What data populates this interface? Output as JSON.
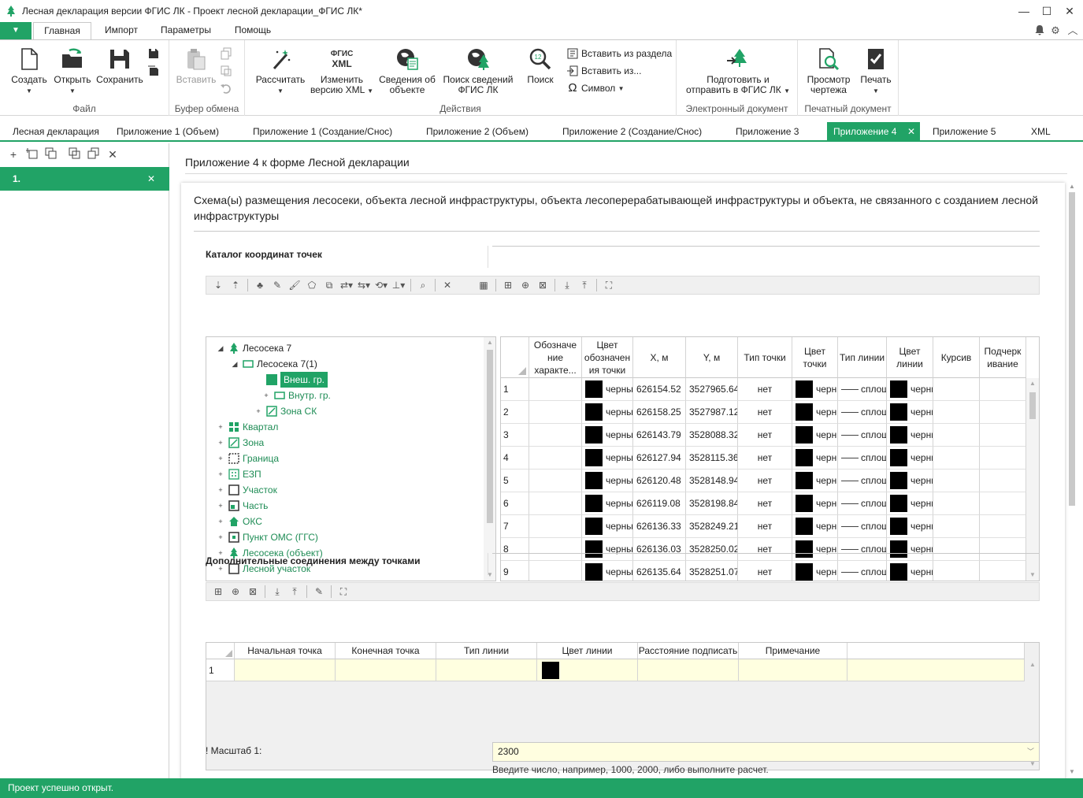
{
  "window": {
    "title": "Лесная декларация версии ФГИС ЛК - Проект лесной декларации_ФГИС ЛК*",
    "minimize": "—",
    "maximize": "☐",
    "close": "✕"
  },
  "ribbon_tabs": {
    "file_menu": "▼",
    "tabs": [
      {
        "label": "Главная",
        "active": true
      },
      {
        "label": "Импорт"
      },
      {
        "label": "Параметры"
      },
      {
        "label": "Помощь"
      }
    ]
  },
  "ribbon": {
    "groups": {
      "file": {
        "label": "Файл",
        "create": "Создать",
        "open": "Открыть",
        "save": "Сохранить"
      },
      "clipboard": {
        "label": "Буфер обмена",
        "paste": "Вставить"
      },
      "actions": {
        "label": "Действия",
        "calculate": "Рассчитать",
        "change_xml_1": "Изменить",
        "change_xml_2": "версию XML",
        "xml_badge_1": "ФГИС",
        "xml_badge_2": "XML",
        "object_info_1": "Сведения об",
        "object_info_2": "объекте",
        "search_info_1": "Поиск сведений",
        "search_info_2": "ФГИС ЛК",
        "search": "Поиск",
        "insert_from_section": "Вставить из раздела",
        "insert_from": "Вставить из...",
        "symbol": "Символ"
      },
      "edoc": {
        "label": "Электронный документ",
        "prepare_1": "Подготовить и",
        "prepare_2": "отправить в ФГИС ЛК"
      },
      "print": {
        "label": "Печатный документ",
        "preview_1": "Просмотр",
        "preview_2": "чертежа",
        "print": "Печать"
      }
    }
  },
  "doc_tabs": [
    {
      "label": "Лесная декларация"
    },
    {
      "label": "Приложение 1 (Объем)"
    },
    {
      "label": "Приложение 1 (Создание/Снос)"
    },
    {
      "label": "Приложение 2 (Объем)"
    },
    {
      "label": "Приложение 2 (Создание/Снос)"
    },
    {
      "label": "Приложение 3"
    },
    {
      "label": "Приложение 4",
      "active": true,
      "close": "✕"
    },
    {
      "label": "Приложение 5"
    },
    {
      "label": "XML"
    }
  ],
  "left_panel": {
    "item_label": "1.",
    "item_close": "✕"
  },
  "main": {
    "page_title": "Приложение 4 к форме Лесной декларации",
    "card_title": "Схема(ы) размещения лесосеки, объекта лесной инфраструктуры, объекта лесоперерабатывающей инфраструктуры и объекта, не связанного с созданием лесной инфраструктуры",
    "catalog_label": "Каталог координат точек",
    "connections_label": "Дополнительные соединения между точками",
    "scale_label": "! Масштаб 1:",
    "scale_value": "2300",
    "scale_hint": "Введите число, например, 1000, 2000, либо выполните расчет."
  },
  "tree": [
    {
      "label": "Лесосека 7",
      "exp": "◢",
      "icon": "tree-icon",
      "level": 0,
      "dark": true
    },
    {
      "label": "Лесосека 7(1)",
      "exp": "◢",
      "icon": "rect-icon",
      "level": 1,
      "dark": true
    },
    {
      "label": "Внеш. гр.",
      "exp": "",
      "icon": "rect-icon",
      "level": 2,
      "selected": true
    },
    {
      "label": "Внутр. гр.",
      "exp": "+",
      "icon": "rect-icon",
      "level": 3
    },
    {
      "label": "Зона СК",
      "exp": "+",
      "icon": "zone-icon",
      "level": 2
    },
    {
      "label": "Квартал",
      "exp": "+",
      "icon": "grid-icon",
      "level": 0
    },
    {
      "label": "Зона",
      "exp": "+",
      "icon": "zone-icon",
      "level": 0
    },
    {
      "label": "Граница",
      "exp": "+",
      "icon": "dashed-rect-icon",
      "level": 0
    },
    {
      "label": "ЕЗП",
      "exp": "+",
      "icon": "dots-icon",
      "level": 0
    },
    {
      "label": "Участок",
      "exp": "+",
      "icon": "square-icon",
      "level": 0
    },
    {
      "label": "Часть",
      "exp": "+",
      "icon": "part-icon",
      "level": 0
    },
    {
      "label": "ОКС",
      "exp": "+",
      "icon": "house-icon",
      "level": 0
    },
    {
      "label": "Пункт ОМС (ГГС)",
      "exp": "+",
      "icon": "point-icon",
      "level": 0
    },
    {
      "label": "Лесосека (объект)",
      "exp": "+",
      "icon": "tree-icon",
      "level": 0
    },
    {
      "label": "Лесной участок",
      "exp": "+",
      "icon": "square-icon",
      "level": 0
    }
  ],
  "coord_grid": {
    "headers": [
      "",
      "Обозначе ние характе...",
      "Цвет обозначен ия точки",
      "X, м",
      "Y, м",
      "Тип точки",
      "Цвет точки",
      "Тип линии",
      "Цвет линии",
      "Курсив",
      "Подчерк ивание"
    ],
    "rows": [
      {
        "n": "1",
        "color": "черный",
        "x": "626154.52",
        "y": "3527965.64",
        "type": "нет",
        "pcolor": "черный",
        "ltype": "сплошная",
        "lcolor": "черный"
      },
      {
        "n": "2",
        "color": "черный",
        "x": "626158.25",
        "y": "3527987.12",
        "type": "нет",
        "pcolor": "черный",
        "ltype": "сплошная",
        "lcolor": "черный"
      },
      {
        "n": "3",
        "color": "черный",
        "x": "626143.79",
        "y": "3528088.32",
        "type": "нет",
        "pcolor": "черный",
        "ltype": "сплошная",
        "lcolor": "черный"
      },
      {
        "n": "4",
        "color": "черный",
        "x": "626127.94",
        "y": "3528115.36",
        "type": "нет",
        "pcolor": "черный",
        "ltype": "сплошная",
        "lcolor": "черный"
      },
      {
        "n": "5",
        "color": "черный",
        "x": "626120.48",
        "y": "3528148.94",
        "type": "нет",
        "pcolor": "черный",
        "ltype": "сплошная",
        "lcolor": "черный"
      },
      {
        "n": "6",
        "color": "черный",
        "x": "626119.08",
        "y": "3528198.84",
        "type": "нет",
        "pcolor": "черный",
        "ltype": "сплошная",
        "lcolor": "черный"
      },
      {
        "n": "7",
        "color": "черный",
        "x": "626136.33",
        "y": "3528249.21",
        "type": "нет",
        "pcolor": "черный",
        "ltype": "сплошная",
        "lcolor": "черный"
      },
      {
        "n": "8",
        "color": "черный",
        "x": "626136.03",
        "y": "3528250.02",
        "type": "нет",
        "pcolor": "черный",
        "ltype": "сплошная",
        "lcolor": "черный"
      },
      {
        "n": "9",
        "color": "черный",
        "x": "626135.64",
        "y": "3528251.07",
        "type": "нет",
        "pcolor": "черный",
        "ltype": "сплошная",
        "lcolor": "черный"
      }
    ]
  },
  "conn_grid": {
    "headers": [
      "",
      "Начальная точка",
      "Конечная точка",
      "Тип линии",
      "Цвет линии",
      "Расстояние подписать",
      "Примечание",
      ""
    ],
    "row_number": "1"
  },
  "status": {
    "text": "Проект успешно открыт."
  },
  "colors": {
    "accent": "#21a366"
  }
}
